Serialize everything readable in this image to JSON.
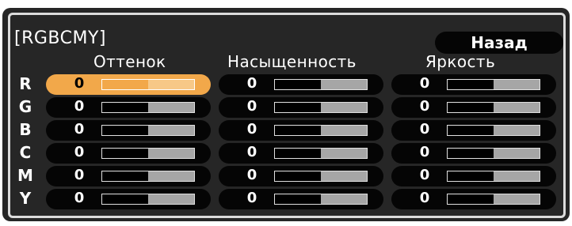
{
  "title": "[RGBCMY]",
  "back_label": "Назад",
  "columns": [
    "Оттенок",
    "Насыщенность",
    "Яркость"
  ],
  "rows": [
    {
      "label": "R",
      "values": [
        "0",
        "0",
        "0"
      ],
      "fill": [
        0.5,
        0.5,
        0.5
      ],
      "selected_col": 0
    },
    {
      "label": "G",
      "values": [
        "0",
        "0",
        "0"
      ],
      "fill": [
        0.5,
        0.5,
        0.5
      ],
      "selected_col": -1
    },
    {
      "label": "B",
      "values": [
        "0",
        "0",
        "0"
      ],
      "fill": [
        0.5,
        0.5,
        0.5
      ],
      "selected_col": -1
    },
    {
      "label": "C",
      "values": [
        "0",
        "0",
        "0"
      ],
      "fill": [
        0.5,
        0.5,
        0.5
      ],
      "selected_col": -1
    },
    {
      "label": "M",
      "values": [
        "0",
        "0",
        "0"
      ],
      "fill": [
        0.5,
        0.5,
        0.5
      ],
      "selected_col": -1
    },
    {
      "label": "Y",
      "values": [
        "0",
        "0",
        "0"
      ],
      "fill": [
        0.5,
        0.5,
        0.5
      ],
      "selected_col": -1
    }
  ]
}
